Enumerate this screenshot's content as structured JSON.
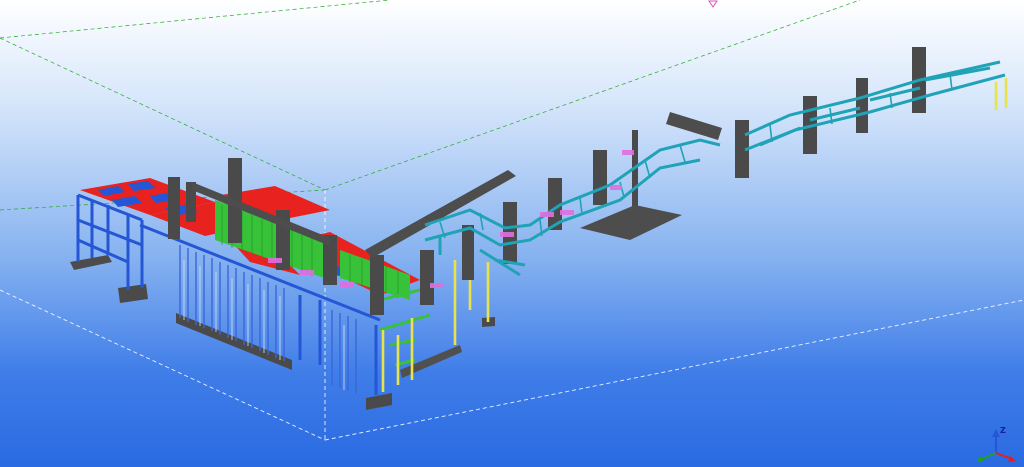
{
  "viewport": {
    "axis_gizmo": {
      "z_label": "Z"
    },
    "colors": {
      "bg_top": "#ffffff",
      "bg_bottom": "#2a6ae2",
      "red_members": "#e8231f",
      "blue_members": "#2456d6",
      "green_members": "#37c23a",
      "cyan_members": "#20a3b6",
      "yellow_members": "#e8e34a",
      "magenta_plates": "#e06ee0",
      "concrete": "#4a4a4a"
    }
  }
}
